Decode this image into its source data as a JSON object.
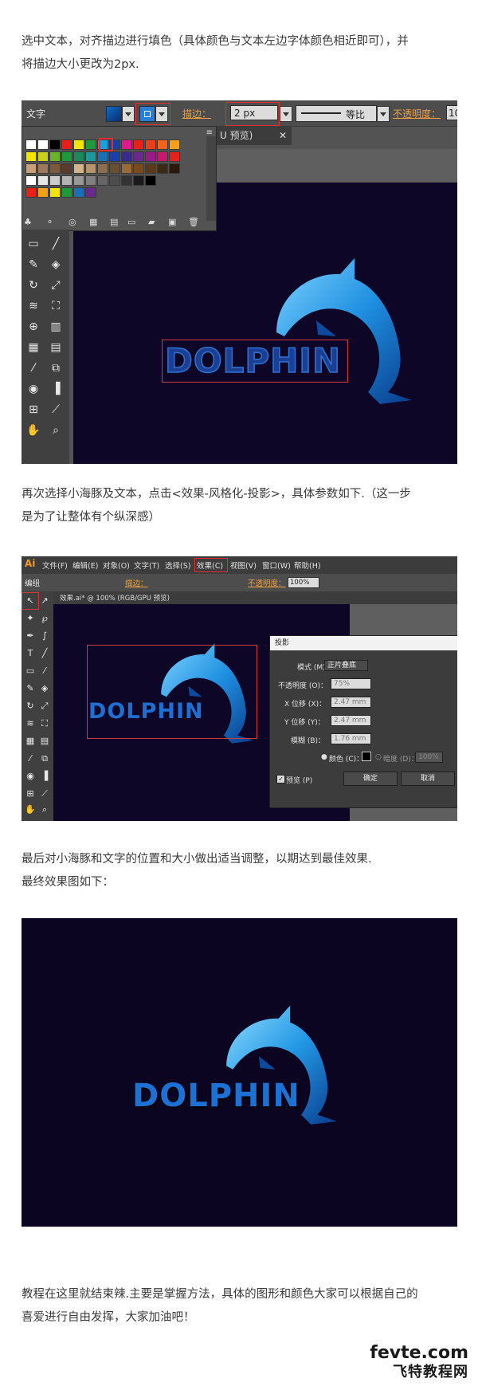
{
  "paragraphs": {
    "p1": [
      "选中文本，对齐描边进行填色（具体颜色与文本左边字体颜色相近即可），并",
      "将描边大小更改为2px."
    ],
    "p2": [
      "再次选择小海豚及文本，点击<效果-风格化-投影>，具体参数如下.（这一步",
      "是为了让整体有个纵深感）"
    ],
    "p3": [
      "最后对小海豚和文字的位置和大小做出适当调整，以期达到最佳效果.",
      "最终效果图如下："
    ],
    "p4": [
      "教程在这里就结束辣.主要是掌握方法，具体的图形和颜色大家可以根据自己的",
      "喜爱进行自由发挥，大家加油吧！"
    ]
  },
  "screenshot1": {
    "control_label": "文字",
    "stroke_label": "描边：",
    "stroke_value": "2 px",
    "profile_label": "等比",
    "opacity_label": "不透明度：",
    "opacity_value": "10",
    "tab_label": "U 预览)",
    "logo_text": "DOLPHIN",
    "colors": {
      "text_fill": "#1a3c8c",
      "text_stroke": "#2c6fd0",
      "canvas": "#0d0626"
    }
  },
  "screenshot2": {
    "app_logo": "Ai",
    "menu": [
      "文件(F)",
      "编辑(E)",
      "对象(O)",
      "文字(T)",
      "选择(S)",
      "效果(C)",
      "视图(V)",
      "窗口(W)",
      "帮助(H)"
    ],
    "selected_menu": "效果(C)",
    "control_label": "编组",
    "stroke_label": "描边：",
    "opacity_label": "不透明度：",
    "opacity_value": "100%",
    "document_tab": "效果.ai* @ 100% (RGB/GPU 预览)",
    "logo_text": "DOLPHIN",
    "dialog": {
      "title": "投影",
      "mode_label": "模式 (M)：",
      "mode_value": "正片叠底",
      "opacity_label": "不透明度 (O)：",
      "opacity_value": "75%",
      "x_label": "X 位移 (X)：",
      "x_value": "2.47 mm",
      "y_label": "Y 位移 (Y)：",
      "y_value": "2.47 mm",
      "blur_label": "模糊 (B)：",
      "blur_value": "1.76 mm",
      "color_label": "颜色 (C)：",
      "darkness_label": "暗度 (D)：",
      "darkness_value": "100%",
      "preview_label": "预览 (P)",
      "ok_label": "确定",
      "cancel_label": "取消"
    }
  },
  "final_image": {
    "logo_text": "DOLPHIN"
  },
  "watermark": {
    "domain": "fevte.com",
    "site_name": "飞特教程网"
  }
}
